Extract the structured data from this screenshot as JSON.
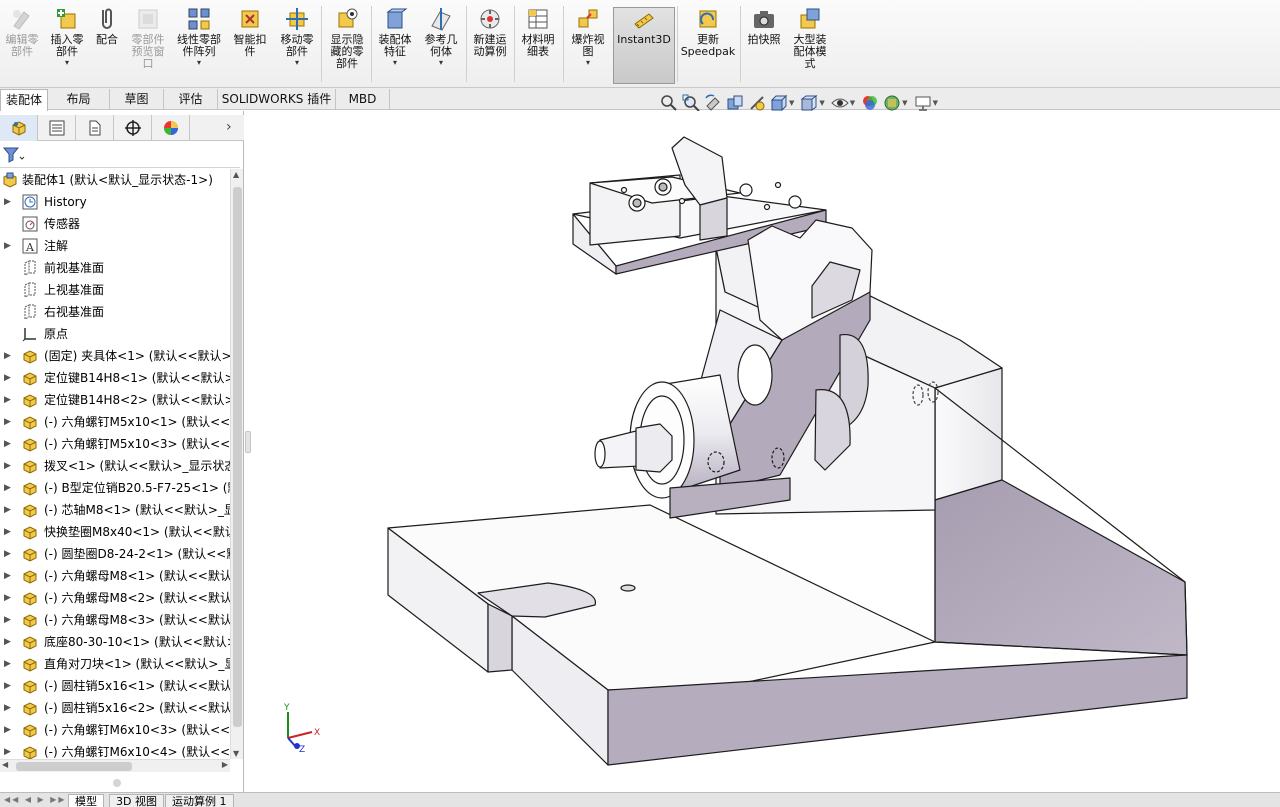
{
  "ribbon": {
    "buttons": [
      {
        "label": "编辑零\n部件",
        "icon": "edit-component-icon",
        "disabled": true
      },
      {
        "label": "插入零\n部件",
        "icon": "insert-component-icon",
        "dropdown": "▾"
      },
      {
        "label": "配合",
        "icon": "mate-icon"
      },
      {
        "label": "零部件\n预览窗\n口",
        "icon": "component-preview-icon",
        "disabled": true
      },
      {
        "label": "线性零部\n件阵列",
        "icon": "linear-pattern-icon",
        "dropdown": "▾"
      },
      {
        "label": "智能扣\n件",
        "icon": "smart-fasteners-icon"
      },
      {
        "label": "移动零\n部件",
        "icon": "move-component-icon",
        "dropdown": "▾"
      },
      {
        "label": "显示隐\n藏的零\n部件",
        "icon": "show-hidden-icon"
      },
      {
        "label": "装配体\n特征",
        "icon": "assembly-feature-icon",
        "dropdown": "▾"
      },
      {
        "label": "参考几\n何体",
        "icon": "reference-geometry-icon",
        "dropdown": "▾"
      },
      {
        "label": "新建运\n动算例",
        "icon": "motion-study-icon"
      },
      {
        "label": "材料明\n细表",
        "icon": "bom-icon"
      },
      {
        "label": "爆炸视\n图",
        "icon": "exploded-view-icon",
        "dropdown": "▾"
      },
      {
        "label": "Instant3D",
        "icon": "instant3d-icon"
      },
      {
        "label": "更新\nSpeedpak",
        "icon": "speedpak-icon"
      },
      {
        "label": "拍快照",
        "icon": "snapshot-icon"
      },
      {
        "label": "大型装\n配体模\n式",
        "icon": "large-assembly-icon"
      }
    ]
  },
  "command_tabs": [
    "装配体",
    "布局",
    "草图",
    "评估",
    "SOLIDWORKS 插件",
    "MBD"
  ],
  "panel_tabs": [
    "feature-manager-icon",
    "property-manager-icon",
    "configuration-manager-icon",
    "dimxpert-icon",
    "display-manager-icon"
  ],
  "tree": {
    "root": "装配体1  (默认<默认_显示状态-1>)",
    "items": [
      {
        "label": "History",
        "icon": "history-icon",
        "expand": true
      },
      {
        "label": "传感器",
        "icon": "sensor-icon",
        "expand": false
      },
      {
        "label": "注解",
        "icon": "annotation-icon",
        "expand": true
      },
      {
        "label": "前视基准面",
        "icon": "plane-icon",
        "expand": false
      },
      {
        "label": "上视基准面",
        "icon": "plane-icon",
        "expand": false
      },
      {
        "label": "右视基准面",
        "icon": "plane-icon",
        "expand": false
      },
      {
        "label": "原点",
        "icon": "origin-icon",
        "expand": false
      },
      {
        "label": "(固定) 夹具体<1> (默认<<默认>_",
        "icon": "part-icon",
        "expand": true
      },
      {
        "label": "定位键B14H8<1> (默认<<默认>",
        "icon": "part-icon",
        "expand": true
      },
      {
        "label": "定位键B14H8<2> (默认<<默认>",
        "icon": "part-icon",
        "expand": true
      },
      {
        "label": "(-) 六角螺钉M5x10<1> (默认<<默",
        "icon": "part-icon",
        "expand": true
      },
      {
        "label": "(-) 六角螺钉M5x10<3> (默认<<默",
        "icon": "part-icon",
        "expand": true
      },
      {
        "label": "拨叉<1> (默认<<默认>_显示状态",
        "icon": "part-icon",
        "expand": true
      },
      {
        "label": "(-) B型定位销B20.5-F7-25<1> (默",
        "icon": "part-icon",
        "expand": true
      },
      {
        "label": "(-) 芯轴M8<1> (默认<<默认>_显",
        "icon": "part-icon",
        "expand": true
      },
      {
        "label": "快换垫圈M8x40<1> (默认<<默认",
        "icon": "part-icon",
        "expand": true
      },
      {
        "label": "(-) 圆垫圈D8-24-2<1> (默认<<默",
        "icon": "part-icon",
        "expand": true
      },
      {
        "label": "(-) 六角螺母M8<1> (默认<<默认",
        "icon": "part-icon",
        "expand": true
      },
      {
        "label": "(-) 六角螺母M8<2> (默认<<默认",
        "icon": "part-icon",
        "expand": true
      },
      {
        "label": "(-) 六角螺母M8<3> (默认<<默认",
        "icon": "part-icon",
        "expand": true
      },
      {
        "label": "底座80-30-10<1> (默认<<默认>",
        "icon": "part-icon",
        "expand": true
      },
      {
        "label": "直角对刀块<1> (默认<<默认>_显",
        "icon": "part-icon",
        "expand": true
      },
      {
        "label": "(-) 圆柱销5x16<1> (默认<<默认:",
        "icon": "part-icon",
        "expand": true
      },
      {
        "label": "(-) 圆柱销5x16<2> (默认<<默认:",
        "icon": "part-icon",
        "expand": true
      },
      {
        "label": "(-) 六角螺钉M6x10<3> (默认<<默",
        "icon": "part-icon",
        "expand": true
      },
      {
        "label": "(-) 六角螺钉M6x10<4> (默认<<默",
        "icon": "part-icon",
        "expand": true
      }
    ]
  },
  "bottom_tabs": [
    "模型",
    "3D 视图",
    "运动算例 1"
  ],
  "triad": {
    "x": "X",
    "y": "Y",
    "z": "Z"
  },
  "colors": {
    "accent": "#ffcc33",
    "part_shade": "#b5acbb",
    "part_light": "#f4f4f6"
  }
}
